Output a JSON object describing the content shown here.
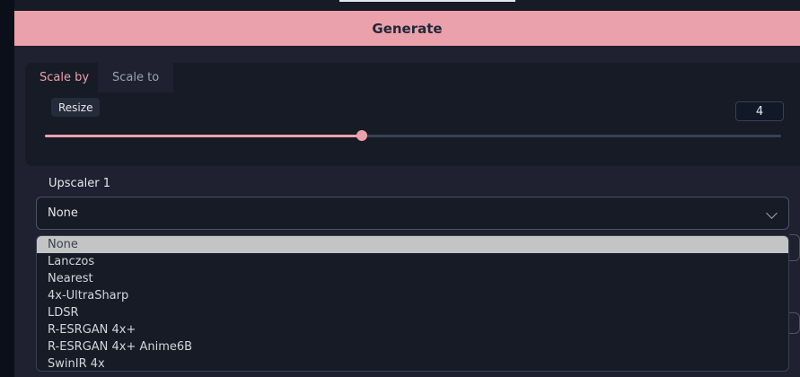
{
  "toolbar": {
    "generate_label": "Generate"
  },
  "tabs": [
    {
      "label": "Scale by",
      "active": true
    },
    {
      "label": "Scale to",
      "active": false
    }
  ],
  "resize": {
    "label": "Resize",
    "value": "4",
    "slider_fraction": 0.43
  },
  "upscaler": {
    "label": "Upscaler 1",
    "selected": "None",
    "options": [
      "None",
      "Lanczos",
      "Nearest",
      "4x-UltraSharp",
      "LDSR",
      "R-ESRGAN 4x+",
      "R-ESRGAN 4x+ Anime6B",
      "SwinIR 4x"
    ]
  },
  "colors": {
    "accent": "#eba1ac",
    "background": "#0b0f19",
    "panel": "#1f2130"
  },
  "icons": {
    "dropdown": "chevron-down-icon"
  }
}
